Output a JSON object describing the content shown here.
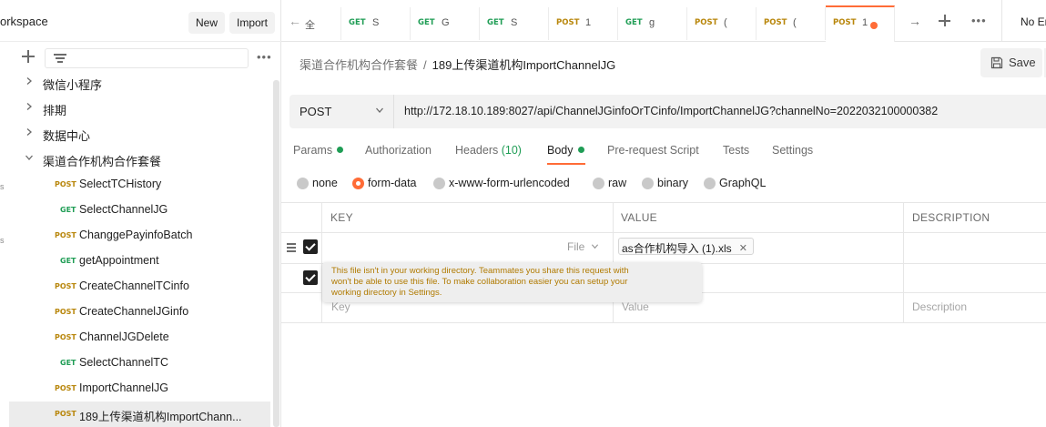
{
  "workspace": {
    "title": "orkspace",
    "new_label": "New",
    "import_label": "Import"
  },
  "sidebar": {
    "items": [
      {
        "kind": "folder",
        "label": "微信小程序",
        "expanded": false
      },
      {
        "kind": "folder",
        "label": "排期",
        "expanded": false
      },
      {
        "kind": "folder",
        "label": "数据中心",
        "expanded": false
      },
      {
        "kind": "folder",
        "label": "渠道合作机构合作套餐",
        "expanded": true
      },
      {
        "kind": "request",
        "method": "POST",
        "label": "SelectTCHistory"
      },
      {
        "kind": "request",
        "method": "GET",
        "label": "SelectChannelJG"
      },
      {
        "kind": "request",
        "method": "POST",
        "label": "ChanggePayinfoBatch"
      },
      {
        "kind": "request",
        "method": "GET",
        "label": "getAppointment"
      },
      {
        "kind": "request",
        "method": "POST",
        "label": "CreateChannelTCinfo"
      },
      {
        "kind": "request",
        "method": "POST",
        "label": "CreateChannelJGinfo"
      },
      {
        "kind": "request",
        "method": "POST",
        "label": "ChannelJGDelete"
      },
      {
        "kind": "request",
        "method": "GET",
        "label": "SelectChannelTC"
      },
      {
        "kind": "request",
        "method": "POST",
        "label": "ImportChannelJG"
      },
      {
        "kind": "request",
        "method": "POST",
        "label": "189上传渠道机构ImportChann..."
      }
    ],
    "edge_marks": [
      "s",
      "s"
    ]
  },
  "tabs": [
    {
      "method": "",
      "label": "全"
    },
    {
      "method": "GET",
      "label": "S"
    },
    {
      "method": "GET",
      "label": "G"
    },
    {
      "method": "GET",
      "label": "S"
    },
    {
      "method": "POST",
      "label": "1"
    },
    {
      "method": "GET",
      "label": "g"
    },
    {
      "method": "POST",
      "label": "("
    },
    {
      "method": "POST",
      "label": "("
    },
    {
      "method": "POST",
      "label": "1"
    }
  ],
  "environment": {
    "label": "No En"
  },
  "breadcrumb": {
    "parent": "渠道合作机构合作套餐",
    "separator": "/",
    "current": "189上传渠道机构ImportChannelJG"
  },
  "toolbar": {
    "save_label": "Save"
  },
  "request": {
    "method": "POST",
    "url": "http://172.18.10.189:8027/api/ChannelJGinfoOrTCinfo/ImportChannelJG?channelNo=2022032100000382"
  },
  "request_tabs": {
    "params": "Params",
    "authorization": "Authorization",
    "headers": "Headers",
    "headers_count": "(10)",
    "body": "Body",
    "prerequest": "Pre-request Script",
    "tests": "Tests",
    "settings": "Settings"
  },
  "body_types": [
    "none",
    "form-data",
    "x-www-form-urlencoded",
    "raw",
    "binary",
    "GraphQL"
  ],
  "body_type_selected": "form-data",
  "table": {
    "headers": {
      "key": "KEY",
      "value": "VALUE",
      "description": "DESCRIPTION"
    },
    "row": {
      "type_label": "File",
      "file_name": "as合作机构导入 (1).xls",
      "remove": "✕"
    },
    "placeholders": {
      "key": "Key",
      "value": "Value",
      "description": "Description"
    }
  },
  "tooltip": {
    "lines": [
      "This file isn't in your working directory. Teammates you share this request with",
      "won't be able to use this file. To make collaboration easier you can setup your",
      "working directory in Settings."
    ]
  },
  "colors": {
    "accent": "#ff6c37",
    "post": "#b8860b",
    "get": "#1f9d55",
    "warning_text": "#b07a00"
  }
}
